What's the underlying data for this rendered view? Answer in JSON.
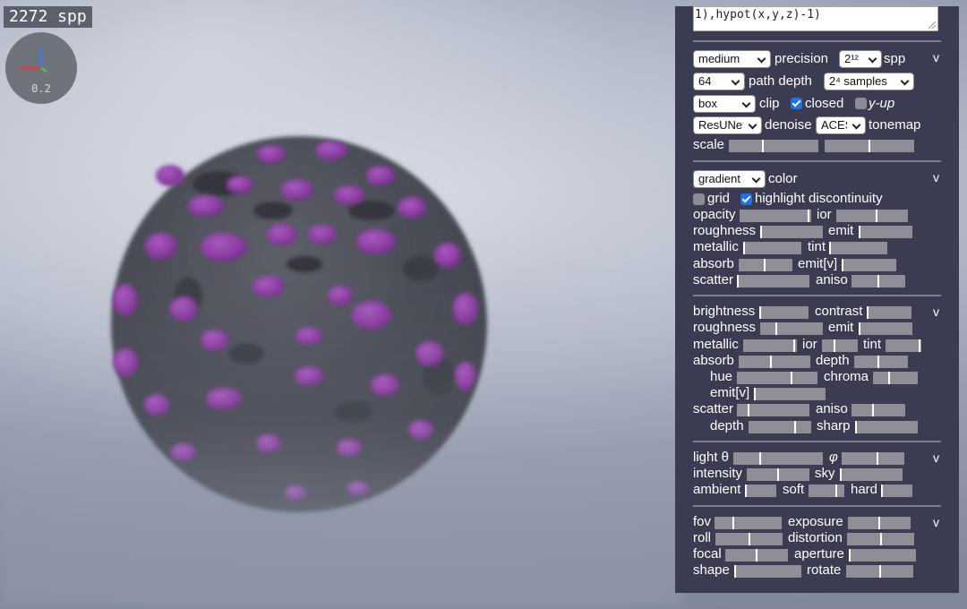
{
  "overlay": {
    "spp_text": "2272 spp",
    "axes_scale": "0.2"
  },
  "panel": {
    "expression": "1),hypot(x,y,z)-1)",
    "render": {
      "precision_value": "medium",
      "precision_label": "precision",
      "spp_value": "2¹²",
      "spp_label": "spp",
      "depth_value": "64",
      "depth_label": "path depth",
      "samples_value": "2⁴ samples",
      "clip_value": "box",
      "clip_label": "clip",
      "closed_label": "closed",
      "closed_checked": true,
      "yup_label": "y-up",
      "yup_checked": false,
      "denoise_value": "ResUNet",
      "denoise_label": "denoise",
      "tonemap_value": "ACES",
      "tonemap_label": "tonemap",
      "scale_label": "scale",
      "scale_a": 0.38,
      "scale_b": 0.5,
      "collapse": "v"
    },
    "material": {
      "color_value": "gradient",
      "color_label": "color",
      "grid_label": "grid",
      "grid_checked": false,
      "highlight_label": "highlight discontinuity",
      "highlight_checked": true,
      "opacity_label": "opacity",
      "opacity": 0.98,
      "ior_label": "ior",
      "ior": 0.57,
      "roughness_label": "roughness",
      "roughness": 0.0,
      "emit_label": "emit",
      "emit": 0.0,
      "metallic_label": "metallic",
      "metallic": 0.0,
      "tint_label": "tint",
      "tint": 0.0,
      "absorb_label": "absorb",
      "absorb": 0.48,
      "emitv_label": "emit[v]",
      "emitv": 0.0,
      "scatter_label": "scatter",
      "scatter": 0.0,
      "aniso_label": "aniso",
      "aniso": 0.5,
      "collapse": "v"
    },
    "layer2": {
      "brightness_label": "brightness",
      "brightness": 0.0,
      "contrast_label": "contrast",
      "contrast": 0.0,
      "roughness_label": "roughness",
      "roughness": 0.25,
      "emit_label": "emit",
      "emit": 0.0,
      "metallic_label": "metallic",
      "metallic": 0.97,
      "ior_label": "ior",
      "ior": 0.35,
      "tint_label": "tint",
      "tint": 0.97,
      "absorb_label": "absorb",
      "absorb": 0.45,
      "depth_label": "depth",
      "depth": 0.45,
      "hue_label": "hue",
      "hue": 0.68,
      "chroma_label": "chroma",
      "chroma": 0.35,
      "emitv_label": "emit[v]",
      "emitv": 0.0,
      "scatter_label": "scatter",
      "scatter": 0.15,
      "aniso_label": "aniso",
      "aniso": 0.4,
      "depth2_label": "depth",
      "depth2": 0.75,
      "sharp_label": "sharp",
      "sharp": 0.0,
      "collapse": "v"
    },
    "light": {
      "theta_label": "light θ",
      "theta": 0.3,
      "phi_label": "φ",
      "phi": 0.58,
      "intensity_label": "intensity",
      "intensity": 0.5,
      "sky_label": "sky",
      "sky": 0.0,
      "ambient_label": "ambient",
      "ambient": 0.0,
      "soft_label": "soft",
      "soft": 0.78,
      "hard_label": "hard",
      "hard": 0.0,
      "collapse": "v"
    },
    "camera": {
      "fov_label": "fov",
      "fov": 0.28,
      "exposure_label": "exposure",
      "exposure": 0.5,
      "roll_label": "roll",
      "roll": 0.5,
      "distortion_label": "distortion",
      "distortion": 0.5,
      "focal_label": "focal",
      "focal": 0.5,
      "aperture_label": "aperture",
      "aperture": 0.0,
      "shape_label": "shape",
      "shape": 0.0,
      "rotate_label": "rotate",
      "rotate": 0.5,
      "collapse": "v"
    }
  },
  "colors": {
    "panel_bg": "#3b3c52",
    "purple_bumps": "#9a3fb0",
    "sphere": "#4b4e57",
    "checkbox_on": "#1a73e8"
  }
}
